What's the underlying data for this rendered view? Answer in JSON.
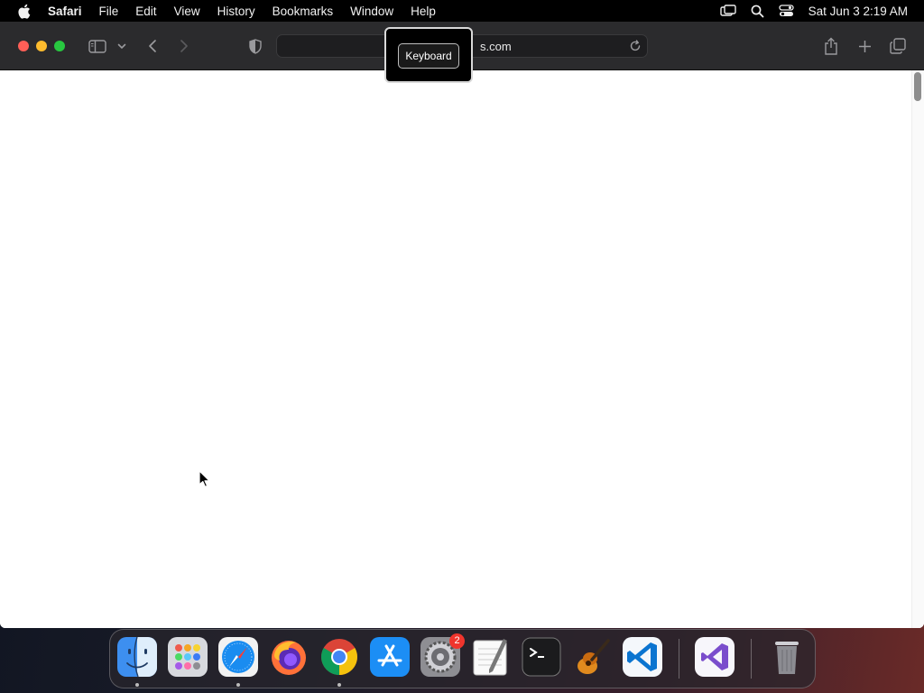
{
  "menubar": {
    "apple_icon": "apple-logo-icon",
    "app_name": "Safari",
    "items": [
      "File",
      "Edit",
      "View",
      "History",
      "Bookmarks",
      "Window",
      "Help"
    ],
    "status_icons": [
      "screen-mirroring-icon",
      "spotlight-search-icon",
      "control-center-icon"
    ],
    "clock": "Sat Jun 3  2:19 AM"
  },
  "safari": {
    "address_text": "s.com",
    "toolbar_icons": [
      "sidebar-icon",
      "chevron-down-icon",
      "back-icon",
      "forward-icon",
      "privacy-shield-icon",
      "reload-icon",
      "share-icon",
      "new-tab-icon",
      "tab-overview-icon"
    ]
  },
  "popover": {
    "label": "Keyboard"
  },
  "dock": {
    "apps": [
      "Finder",
      "Launchpad",
      "Safari",
      "Firefox",
      "Google Chrome",
      "App Store",
      "System Settings",
      "TextEdit",
      "Terminal",
      "GarageBand",
      "Visual Studio Code",
      "Visual Studio",
      "Trash"
    ],
    "system_settings_badge": "2"
  },
  "colors": {
    "close": "#ff5f57",
    "minimize": "#febc2e",
    "zoom": "#28c840",
    "badge": "#f0352d"
  }
}
